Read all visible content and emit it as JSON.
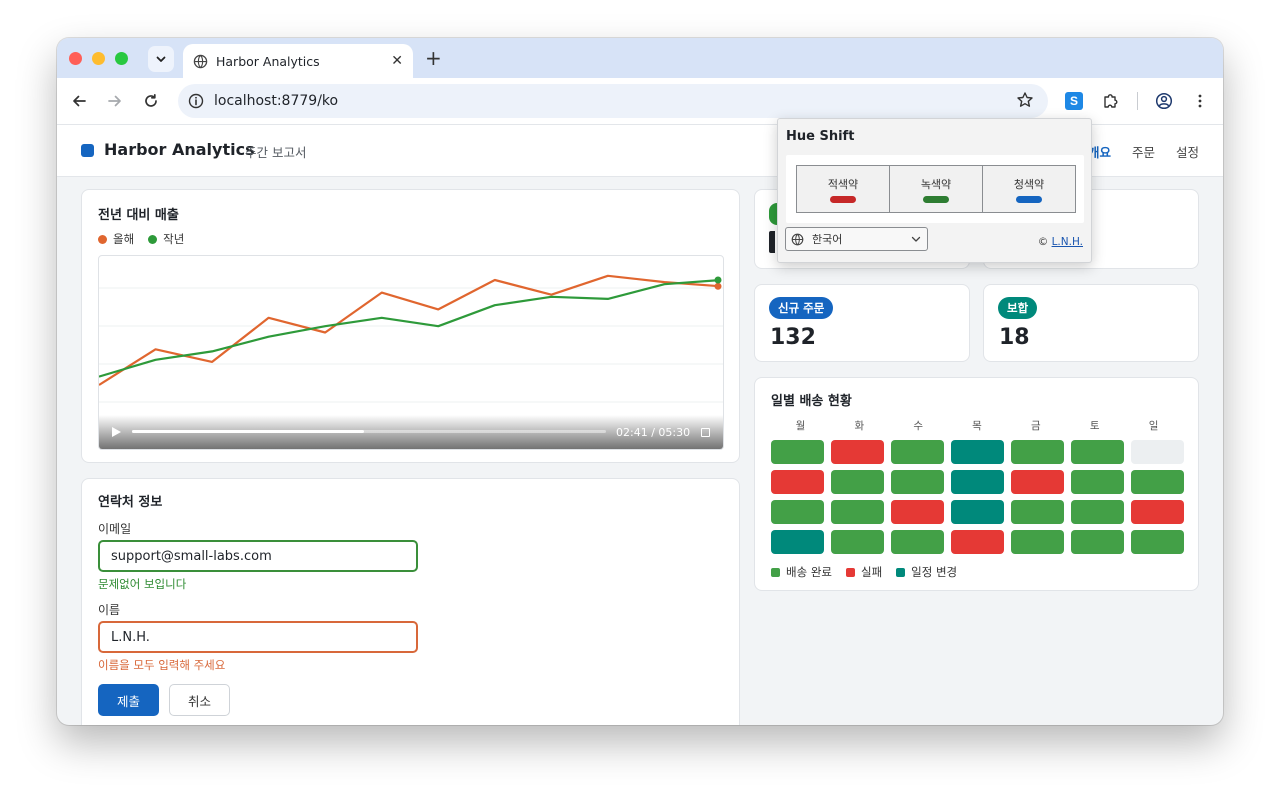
{
  "browser": {
    "tab_title": "Harbor Analytics",
    "url": "localhost:8779/ko",
    "extension_label": "S"
  },
  "app": {
    "brand": "Harbor Analytics",
    "subtitle": "주간 보고서",
    "nav": [
      "개요",
      "주문",
      "설정"
    ],
    "active_nav": "개요"
  },
  "sales": {
    "title": "전년 대비 매출",
    "video_time": "02:41 / 05:30",
    "video_progress": 0.49
  },
  "chart_data": {
    "type": "line",
    "title": "전년 대비 매출",
    "x": [
      1,
      2,
      3,
      4,
      5,
      6,
      7,
      8,
      9,
      10,
      11,
      12
    ],
    "series": [
      {
        "name": "올해",
        "color": "#e0662f",
        "values": [
          10,
          27,
          21,
          42,
          35,
          54,
          46,
          60,
          53,
          62,
          59,
          57
        ]
      },
      {
        "name": "작년",
        "color": "#2e9a3a",
        "values": [
          14,
          22,
          26,
          33,
          38,
          42,
          38,
          48,
          52,
          51,
          58,
          60
        ]
      }
    ],
    "ylim": [
      0,
      100
    ],
    "grid": true,
    "legend": "top-left"
  },
  "contact": {
    "title": "연락처 정보",
    "email_label": "이메일",
    "email_value": "support@small-labs.com",
    "email_hint": "문제없어 보입니다",
    "name_label": "이름",
    "name_value": "L.N.H.",
    "name_hint": "이름을 모두 입력해 주세요",
    "submit": "제출",
    "cancel": "취소"
  },
  "kpis": [
    {
      "label": "신규 주문",
      "value": "132",
      "color": "#1565c0"
    },
    {
      "label": "보합",
      "value": "18",
      "color": "#00897b"
    }
  ],
  "heatmap": {
    "title": "일별 배송 현황",
    "days": [
      "월",
      "화",
      "수",
      "목",
      "금",
      "토",
      "일"
    ],
    "rows": [
      [
        "done",
        "fail",
        "done",
        "resched",
        "done",
        "done",
        "empty"
      ],
      [
        "fail",
        "done",
        "done",
        "resched",
        "fail",
        "done",
        "done"
      ],
      [
        "done",
        "done",
        "fail",
        "resched",
        "done",
        "done",
        "fail"
      ],
      [
        "resched",
        "done",
        "done",
        "fail",
        "done",
        "done",
        "done"
      ]
    ],
    "colors": {
      "done": "#43a047",
      "fail": "#e53935",
      "resched": "#00897b",
      "empty": "#eceff1"
    },
    "legend": [
      {
        "label": "배송 완료",
        "color": "#43a047"
      },
      {
        "label": "실패",
        "color": "#e53935"
      },
      {
        "label": "일정 변경",
        "color": "#00897b"
      }
    ]
  },
  "popup": {
    "title": "Hue Shift",
    "options": [
      {
        "label": "적색약",
        "color": "#c62828"
      },
      {
        "label": "녹색약",
        "color": "#2e7d32"
      },
      {
        "label": "청색약",
        "color": "#1565c0"
      }
    ],
    "language": "한국어",
    "credit_symbol": "©",
    "credit_link": "L.N.H."
  }
}
